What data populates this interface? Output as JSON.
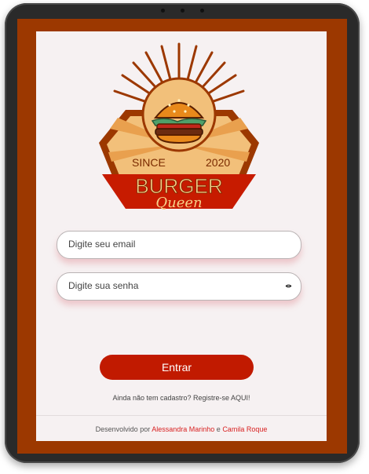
{
  "logo": {
    "since": "SINCE",
    "year": "2020",
    "brand": "BURGER",
    "subbrand": "Queen"
  },
  "form": {
    "email_placeholder": "Digite seu email",
    "password_placeholder": "Digite sua senha",
    "submit_label": "Entrar"
  },
  "register": {
    "prompt": "Ainda não tem cadastro?",
    "link": "Registre-se AQUI!"
  },
  "footer": {
    "prefix": "Desenvolvido por",
    "author1": "Alessandra Marinho",
    "joiner": "e",
    "author2": "Camila Roque"
  },
  "colors": {
    "frame": "#9c3800",
    "screen_bg": "#f6f1f2",
    "button": "#c11a00",
    "footer_link": "#d81f1f"
  },
  "icons": {
    "password_toggle": "eye-icon"
  }
}
